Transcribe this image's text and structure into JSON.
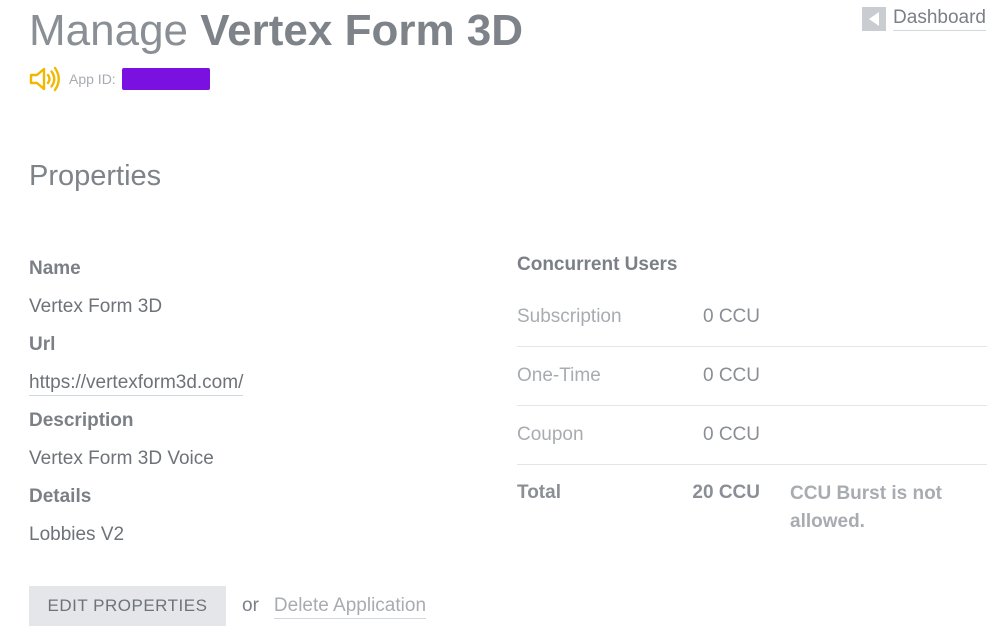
{
  "header": {
    "title_prefix": "Manage",
    "app_name": "Vertex Form 3D",
    "dashboard_label": "Dashboard",
    "app_id_label": "App ID:",
    "app_id_value": "",
    "app_type_icon": "speaker-icon"
  },
  "properties": {
    "section_title": "Properties",
    "name_label": "Name",
    "name_value": "Vertex Form 3D",
    "url_label": "Url",
    "url_value": "https://vertexform3d.com/",
    "description_label": "Description",
    "description_value": "Vertex Form 3D Voice",
    "details_label": "Details",
    "details_value": "Lobbies V2"
  },
  "concurrent_users": {
    "title": "Concurrent Users",
    "rows": [
      {
        "name": "Subscription",
        "value": "0 CCU"
      },
      {
        "name": "One-Time",
        "value": "0 CCU"
      },
      {
        "name": "Coupon",
        "value": "0 CCU"
      }
    ],
    "total": {
      "name": "Total",
      "value": "20 CCU",
      "note": "CCU Burst is not allowed."
    }
  },
  "actions": {
    "edit_label": "EDIT PROPERTIES",
    "or_text": "or",
    "delete_label": "Delete Application"
  },
  "colors": {
    "accent_icon": "#f2b800",
    "redaction": "#7a11e0",
    "button_bg": "#e4e6e9",
    "text": "#7b8087"
  }
}
